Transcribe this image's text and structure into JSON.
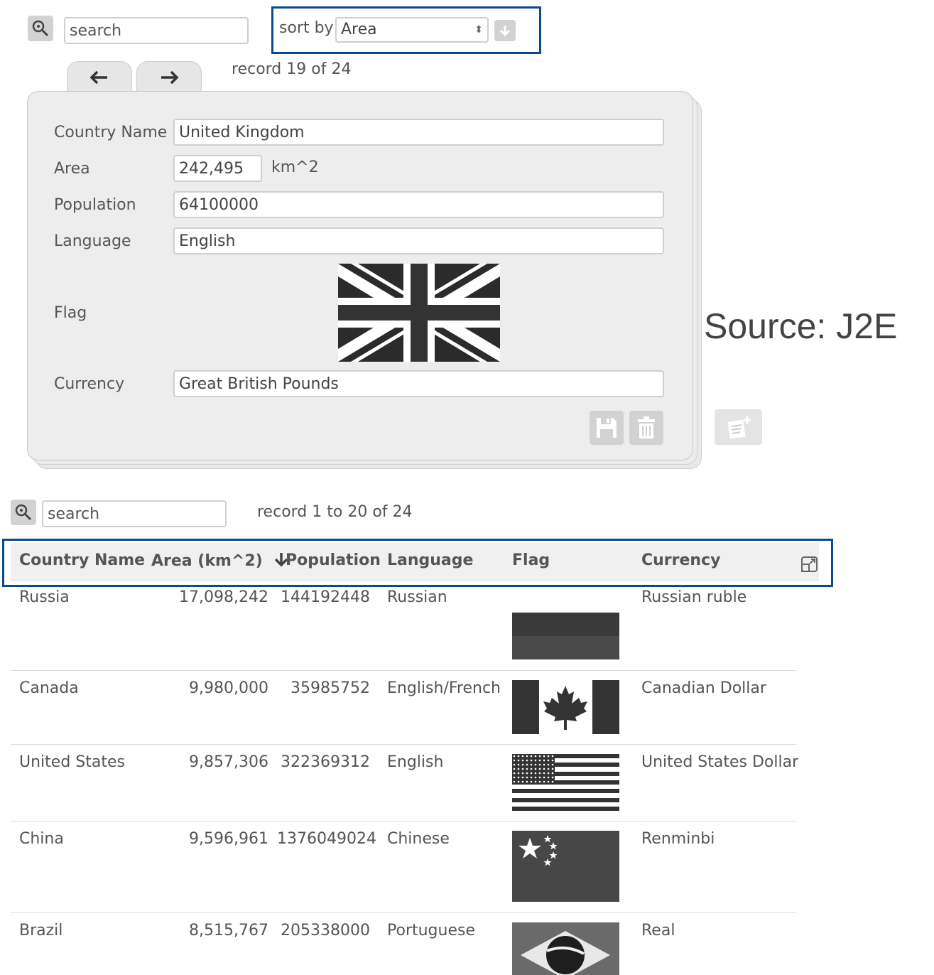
{
  "record_search": {
    "placeholder": "search"
  },
  "sort": {
    "label": "sort by",
    "selected": "Area"
  },
  "record_nav": {
    "status": "record 19 of 24"
  },
  "record": {
    "fields": {
      "country_name": {
        "label": "Country Name",
        "value": "United Kingdom"
      },
      "area": {
        "label": "Area",
        "value": "242,495",
        "unit": "km^2"
      },
      "population": {
        "label": "Population",
        "value": "64100000"
      },
      "language": {
        "label": "Language",
        "value": "English"
      },
      "flag": {
        "label": "Flag",
        "image": "flag-united-kingdom"
      },
      "currency": {
        "label": "Currency",
        "value": "Great British Pounds"
      }
    }
  },
  "watermark": "Source: J2E",
  "list_search": {
    "placeholder": "search"
  },
  "list_status": "record 1 to 20 of 24",
  "table": {
    "columns": [
      "Country Name",
      "Area (km^2)",
      "Population",
      "Language",
      "Flag",
      "Currency"
    ],
    "sorted_column": "Area (km^2)",
    "rows": [
      {
        "country": "Russia",
        "area": "17,098,242",
        "population": "144192448",
        "language": "Russian",
        "flag": "flag-russia",
        "currency": "Russian ruble"
      },
      {
        "country": "Canada",
        "area": "9,980,000",
        "population": "35985752",
        "language": "English/French",
        "flag": "flag-canada",
        "currency": "Canadian Dollar"
      },
      {
        "country": "United States",
        "area": "9,857,306",
        "population": "322369312",
        "language": "English",
        "flag": "flag-united-states",
        "currency": "United States Dollar"
      },
      {
        "country": "China",
        "area": "9,596,961",
        "population": "1376049024",
        "language": "Chinese",
        "flag": "flag-china",
        "currency": "Renminbi"
      },
      {
        "country": "Brazil",
        "area": "8,515,767",
        "population": "205338000",
        "language": "Portuguese",
        "flag": "flag-brazil",
        "currency": "Real"
      }
    ]
  },
  "colors": {
    "highlight": "#0b4a8b",
    "panel": "#ededed",
    "button": "#d2d2d2"
  }
}
